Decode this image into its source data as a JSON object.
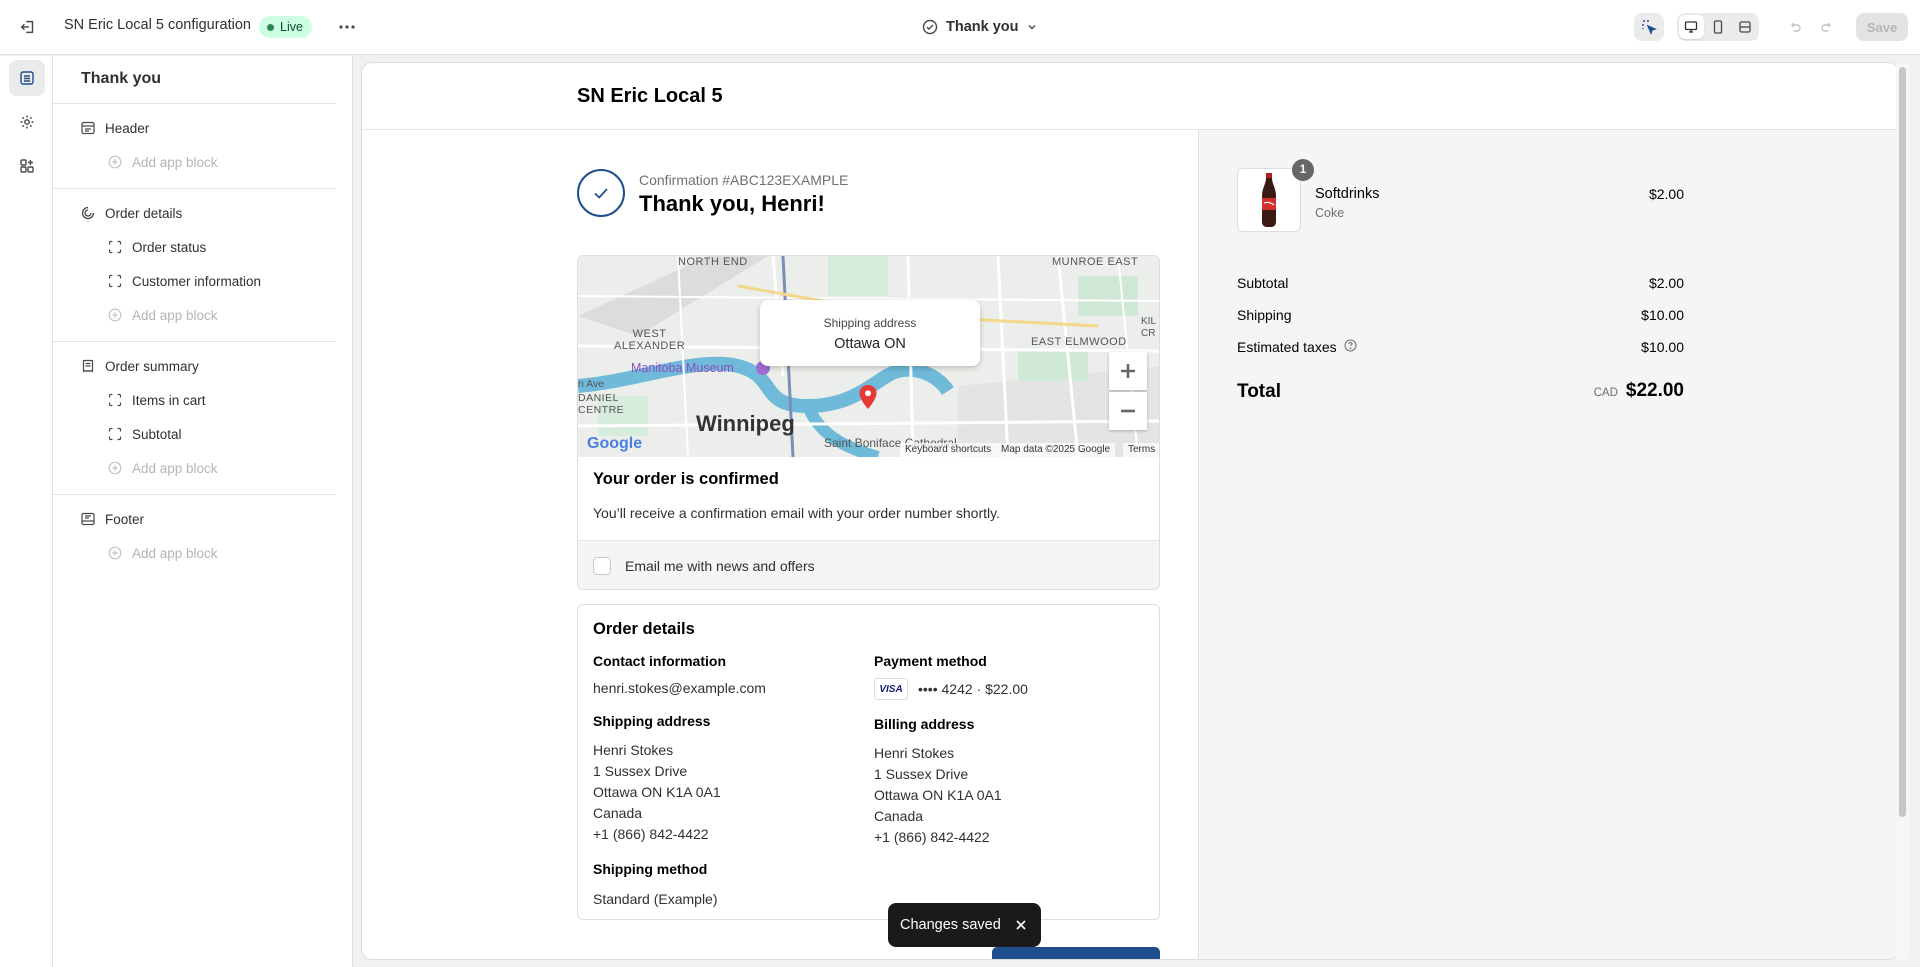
{
  "topbar": {
    "title": "SN Eric Local 5 configuration",
    "status": "Live",
    "page_selector": "Thank you",
    "save_label": "Save"
  },
  "sidebar": {
    "title": "Thank you",
    "sections": {
      "header": {
        "label": "Header",
        "add": "Add app block"
      },
      "order_details": {
        "label": "Order details",
        "items": [
          "Order status",
          "Customer information"
        ],
        "add": "Add app block"
      },
      "order_summary": {
        "label": "Order summary",
        "items": [
          "Items in cart",
          "Subtotal"
        ],
        "add": "Add app block"
      },
      "footer": {
        "label": "Footer",
        "add": "Add app block"
      }
    }
  },
  "preview": {
    "shop_name": "SN Eric Local 5",
    "confirmation_number": "Confirmation #ABC123EXAMPLE",
    "thank_you": "Thank you, Henri!",
    "map": {
      "tooltip_label": "Shipping address",
      "tooltip_value": "Ottawa ON",
      "labels": {
        "north_end": "NORTH END",
        "munroe": "MUNROE EAST",
        "west_alexander": "WEST\nALEXANDER",
        "east_elmwood": "EAST ELMWOOD",
        "museum": "Manitoba Museum",
        "daniel": "DANIEL\nCENTRE",
        "city": "Winnipeg",
        "boniface": "Saint Boniface Cathedral",
        "n_ave": "n Ave",
        "kil": "KIL\nCR"
      },
      "google": "Google",
      "shortcuts": "Keyboard shortcuts",
      "map_data": "Map data ©2025 Google",
      "terms": "Terms"
    },
    "confirmed_title": "Your order is confirmed",
    "confirmed_text": "You’ll receive a confirmation email with your order number shortly.",
    "newsletter": "Email me with news and offers",
    "order_details": {
      "title": "Order details",
      "contact_label": "Contact information",
      "contact_value": "henri.stokes@example.com",
      "payment_label": "Payment method",
      "card_brand": "VISA",
      "payment_value": "•••• 4242 · $22.00",
      "shipping_label": "Shipping address",
      "shipping_lines": [
        "Henri Stokes",
        "1 Sussex Drive",
        "Ottawa ON K1A 0A1",
        "Canada",
        "+1 (866) 842-4422"
      ],
      "billing_label": "Billing address",
      "billing_lines": [
        "Henri Stokes",
        "1 Sussex Drive",
        "Ottawa ON K1A 0A1",
        "Canada",
        "+1 (866) 842-4422"
      ],
      "method_label": "Shipping method",
      "method_value": "Standard (Example)"
    },
    "summary": {
      "quantity": "1",
      "product_name": "Softdrinks",
      "variant": "Coke",
      "product_price": "$2.00",
      "subtotal_label": "Subtotal",
      "subtotal_value": "$2.00",
      "shipping_label": "Shipping",
      "shipping_value": "$10.00",
      "taxes_label": "Estimated taxes",
      "taxes_value": "$10.00",
      "total_label": "Total",
      "currency": "CAD",
      "total_value": "$22.00"
    }
  },
  "toast": {
    "message": "Changes saved"
  },
  "colors": {
    "accent": "#1f4e8c",
    "live_badge": "#cdfee1",
    "map_pin": "#e53935"
  }
}
